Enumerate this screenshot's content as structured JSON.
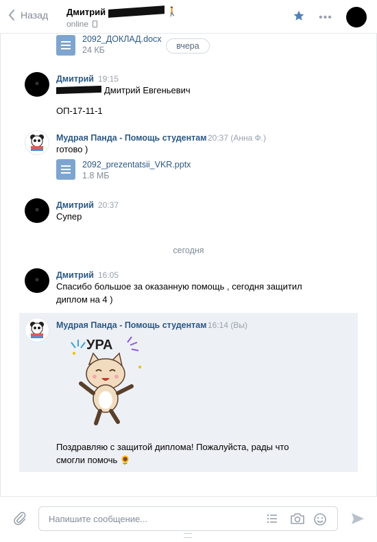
{
  "header": {
    "back_label": "Назад",
    "peer_name": "Дмитрий",
    "peer_status": "online"
  },
  "top_doc": {
    "name": "2092_ДОКЛАД.docx",
    "size": "24 КБ",
    "date_pill": "вчера"
  },
  "messages": [
    {
      "author": "Дмитрий",
      "time": "19:15",
      "lines": [
        "Дмитрий Евгеньевич",
        "ОП-17-11-1"
      ]
    },
    {
      "author": "Мудрая Панда - Помощь студентам",
      "time": "20:37 (Анна Ф.)",
      "text": "готово )",
      "doc": {
        "name": "2092_prezentatsii_VKR.pptx",
        "size": "1.8 МБ"
      }
    },
    {
      "author": "Дмитрий",
      "time": "20:37",
      "text": "Супер"
    },
    {
      "author": "Дмитрий",
      "time": "16:05",
      "lines": [
        "Спасибо большое за оказанную помощь , сегодня защитил",
        "диплом на 4 )"
      ]
    },
    {
      "author": "Мудрая Панда - Помощь студентам",
      "time": "16:14 (Вы)",
      "sticker_text": "УРА",
      "lines": [
        "Поздравляю с защитой диплома! Пожалуйста, рады что",
        "смогли помочь 🌻"
      ]
    }
  ],
  "divider_today": "сегодня",
  "composer": {
    "placeholder": "Напишите сообщение..."
  },
  "colors": {
    "link": "#2a5885",
    "accent": "#5181b8",
    "selected_bg": "#edf0f5"
  }
}
